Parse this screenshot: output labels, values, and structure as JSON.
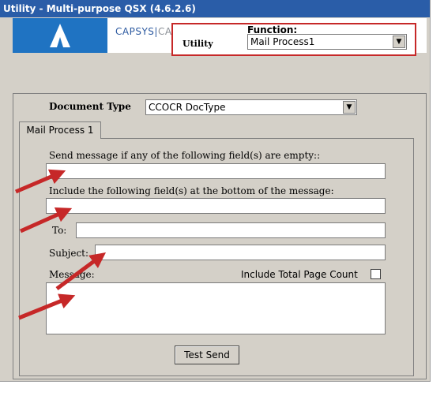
{
  "window": {
    "title": "Utility - Multi-purpose QSX (4.6.2.6)"
  },
  "banner": {
    "brand_left": "CAPSYS",
    "brand_right": "CAPTURE"
  },
  "function": {
    "label": "Function:",
    "sub_label": "Utility",
    "selected": "Mail Process1"
  },
  "document": {
    "type_label": "Document Type",
    "type_selected": "CCOCR DocType"
  },
  "tab": {
    "label": "Mail Process 1"
  },
  "form": {
    "empty_fields_label": "Send message if any of the following field(s) are empty::",
    "empty_fields_value": "",
    "include_fields_label": "Include the following field(s) at the bottom of the message:",
    "include_fields_value": "",
    "to_label": "To:",
    "to_value": "",
    "subject_label": "Subject:",
    "subject_value": "",
    "message_label": "Message:",
    "message_value": "",
    "include_page_count_label": "Include Total Page Count",
    "include_page_count_checked": false,
    "test_send_label": "Test Send"
  },
  "annotation": {
    "arrow_color": "#c62828"
  },
  "colors": {
    "title_bar": "#2a5da8",
    "window_bg": "#d4d0c8",
    "highlight_box": "#c62828",
    "logo_bg": "#1f73c2"
  }
}
